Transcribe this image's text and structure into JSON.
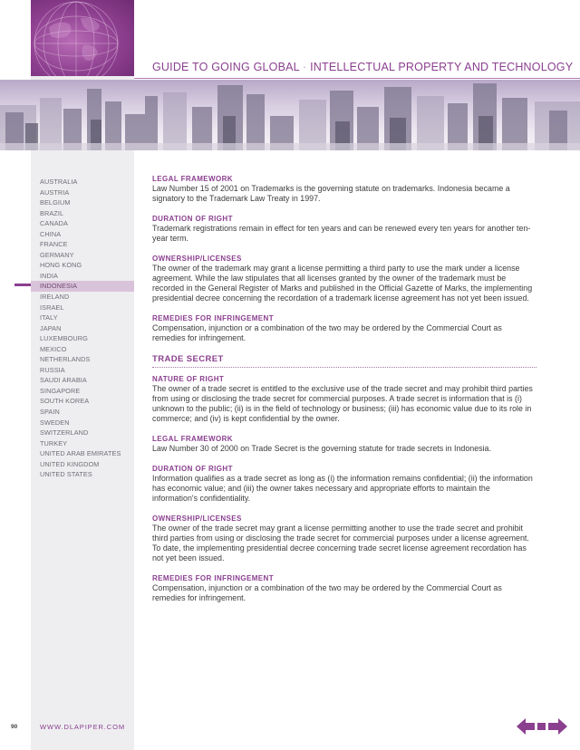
{
  "header": {
    "title_part1": "GUIDE TO GOING GLOBAL",
    "separator": "·",
    "title_part2": "INTELLECTUAL PROPERTY AND TECHNOLOGY"
  },
  "colors": {
    "accent": "#8a3f8f",
    "nav_active": "#d9c3da",
    "band": "#eeeef0"
  },
  "sidebar": {
    "active": "INDONESIA",
    "items": [
      "AUSTRALIA",
      "AUSTRIA",
      "BELGIUM",
      "BRAZIL",
      "CANADA",
      "CHINA",
      "FRANCE",
      "GERMANY",
      "HONG KONG",
      "INDIA",
      "INDONESIA",
      "IRELAND",
      "ISRAEL",
      "ITALY",
      "JAPAN",
      "LUXEMBOURG",
      "MEXICO",
      "NETHERLANDS",
      "RUSSIA",
      "SAUDI ARABIA",
      "SINGAPORE",
      "SOUTH KOREA",
      "SPAIN",
      "SWEDEN",
      "SWITZERLAND",
      "TURKEY",
      "UNITED ARAB EMIRATES",
      "UNITED KINGDOM",
      "UNITED STATES"
    ]
  },
  "trademark": {
    "legal_framework": {
      "heading": "LEGAL FRAMEWORK",
      "text": "Law Number 15 of 2001 on Trademarks is the governing statute on trademarks. Indonesia became a signatory to the Trademark Law Treaty in 1997."
    },
    "duration": {
      "heading": "DURATION OF RIGHT",
      "text": "Trademark registrations remain in effect for ten years and can be renewed every ten years for another ten-year term."
    },
    "ownership": {
      "heading": "OWNERSHIP/LICENSES",
      "text": "The owner of the trademark may grant a license permitting a third party to use the mark under a license agreement. While the law stipulates that all licenses granted by the owner of the trademark must be recorded in the General Register of Marks and published in the Official Gazette of Marks, the implementing presidential decree concerning the recordation of a trademark license agreement has not yet been issued."
    },
    "remedies": {
      "heading": "REMEDIES FOR INFRINGEMENT",
      "text": "Compensation, injunction or a combination of the two may be ordered by the Commercial Court as remedies for infringement."
    }
  },
  "trade_secret": {
    "title": "TRADE SECRET",
    "nature": {
      "heading": "NATURE OF RIGHT",
      "text": "The owner of a trade secret is entitled to the exclusive use of the trade secret and may prohibit third parties from using or disclosing the trade secret for commercial purposes. A trade secret is information that is (i) unknown to the public; (ii) is in the field of technology or business; (iii) has economic value due to its role in commerce; and (iv) is kept confidential by the owner."
    },
    "legal_framework": {
      "heading": "LEGAL FRAMEWORK",
      "text": "Law Number 30 of 2000 on Trade Secret is the governing statute for trade secrets in Indonesia."
    },
    "duration": {
      "heading": "DURATION OF RIGHT",
      "text": "Information qualifies as a trade secret as long as (i) the information remains confidential; (ii) the information has economic value; and (iii) the owner takes necessary and appropriate efforts to maintain the information's confidentiality."
    },
    "ownership": {
      "heading": "OWNERSHIP/LICENSES",
      "text": "The owner of the trade secret may grant a license permitting another to use the trade secret and prohibit third parties from using or disclosing the trade secret for commercial purposes under a license agreement. To date, the implementing presidential decree concerning trade secret license agreement recordation has not yet been issued."
    },
    "remedies": {
      "heading": "REMEDIES FOR INFRINGEMENT",
      "text": "Compensation, injunction or a combination of the two may be ordered by the Commercial Court as remedies for infringement."
    }
  },
  "footer": {
    "page_number": "90",
    "url": "WWW.DLAPIPER.COM"
  },
  "icons": [
    "globe-graphic",
    "city-skyline-image",
    "prev-arrow-icon",
    "next-arrow-icon"
  ]
}
